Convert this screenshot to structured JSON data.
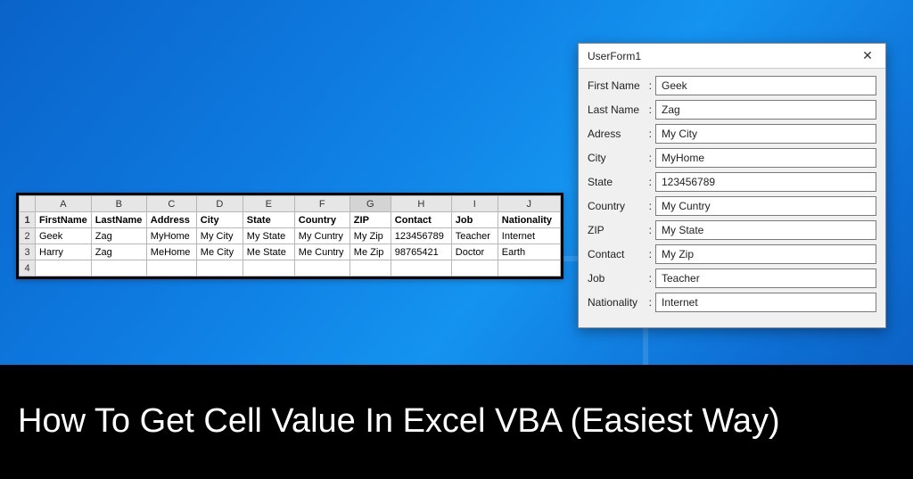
{
  "article": {
    "title": "How To Get Cell Value In Excel VBA (Easiest Way)"
  },
  "excel": {
    "columns": [
      "A",
      "B",
      "C",
      "D",
      "E",
      "F",
      "G",
      "H",
      "I",
      "J"
    ],
    "selected_column": "G",
    "row_numbers": [
      "1",
      "2",
      "3",
      "4"
    ],
    "headers": [
      "FirstName",
      "LastName",
      "Address",
      "City",
      "State",
      "Country",
      "ZIP",
      "Contact",
      "Job",
      "Nationality"
    ],
    "rows": [
      [
        "Geek",
        "Zag",
        "MyHome",
        "My City",
        "My State",
        "My Cuntry",
        "My Zip",
        "123456789",
        "Teacher",
        "Internet"
      ],
      [
        "Harry",
        "Zag",
        "MeHome",
        "Me City",
        "Me State",
        "Me Cuntry",
        "Me Zip",
        "98765421",
        "Doctor",
        "Earth"
      ]
    ]
  },
  "userform": {
    "title": "UserForm1",
    "close_glyph": "✕",
    "fields": [
      {
        "label": "First Name",
        "value": "Geek"
      },
      {
        "label": "Last Name",
        "value": "Zag"
      },
      {
        "label": "Adress",
        "value": "My City"
      },
      {
        "label": "City",
        "value": "MyHome"
      },
      {
        "label": "State",
        "value": "123456789"
      },
      {
        "label": "Country",
        "value": "My Cuntry"
      },
      {
        "label": "ZIP",
        "value": "My State"
      },
      {
        "label": "Contact",
        "value": "My Zip"
      },
      {
        "label": "Job",
        "value": "Teacher"
      },
      {
        "label": "Nationality",
        "value": "Internet"
      }
    ]
  }
}
